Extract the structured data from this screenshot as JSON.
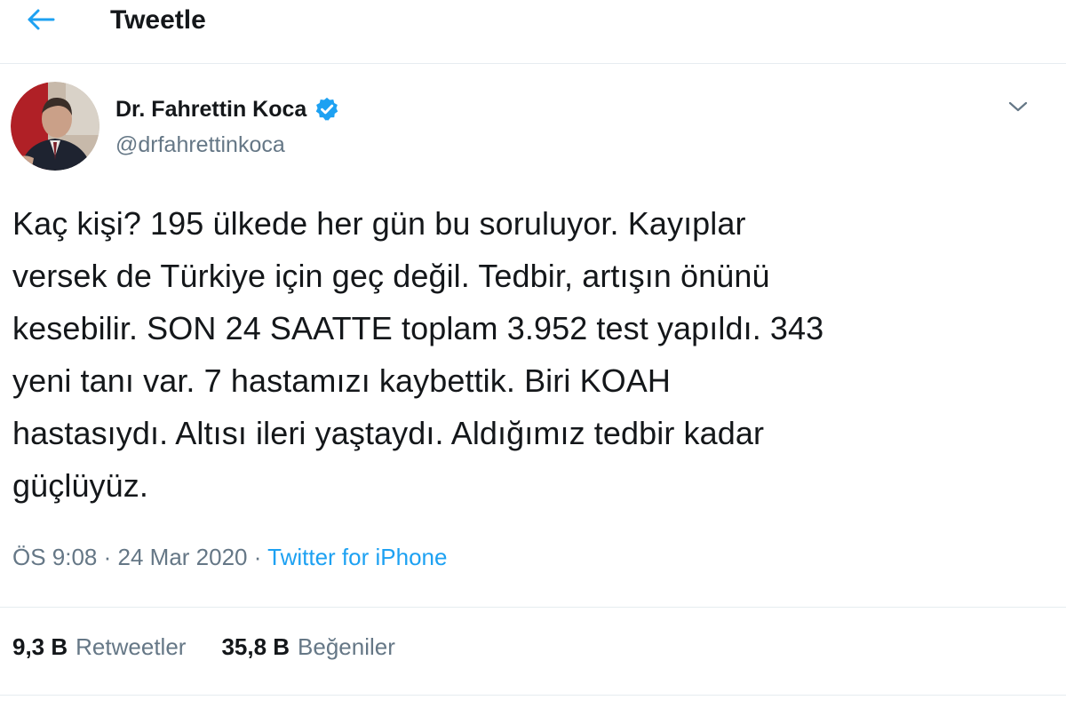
{
  "header": {
    "back_icon": "arrow-left-icon",
    "title": "Tweetle"
  },
  "author": {
    "display_name": "Dr. Fahrettin Koca",
    "handle": "@drfahrettinkoca",
    "verified_icon": "verified-badge-icon",
    "menu_icon": "chevron-down-icon"
  },
  "tweet": {
    "lines": [
      "Kaç kişi? 195 ülkede her gün bu soruluyor. Kayıplar",
      "versek de Türkiye için geç değil. Tedbir, artışın önünü",
      "kesebilir. SON 24 SAATTE toplam 3.952 test yapıldı. 343",
      "yeni tanı var. 7 hastamızı kaybettik. Biri KOAH",
      "hastasıydı. Altısı ileri yaştaydı. Aldığımız tedbir kadar",
      "güçlüyüz."
    ],
    "time": "ÖS 9:08",
    "separator": " · ",
    "date": "24 Mar 2020",
    "source": "Twitter for iPhone"
  },
  "stats": {
    "retweets_count": "9,3 B",
    "retweets_label": "Retweetler",
    "likes_count": "35,8 B",
    "likes_label": "Beğeniler"
  },
  "colors": {
    "accent": "#1da1f2",
    "text_primary": "#14171a",
    "text_secondary": "#657786",
    "divider": "#e6ecf0"
  }
}
